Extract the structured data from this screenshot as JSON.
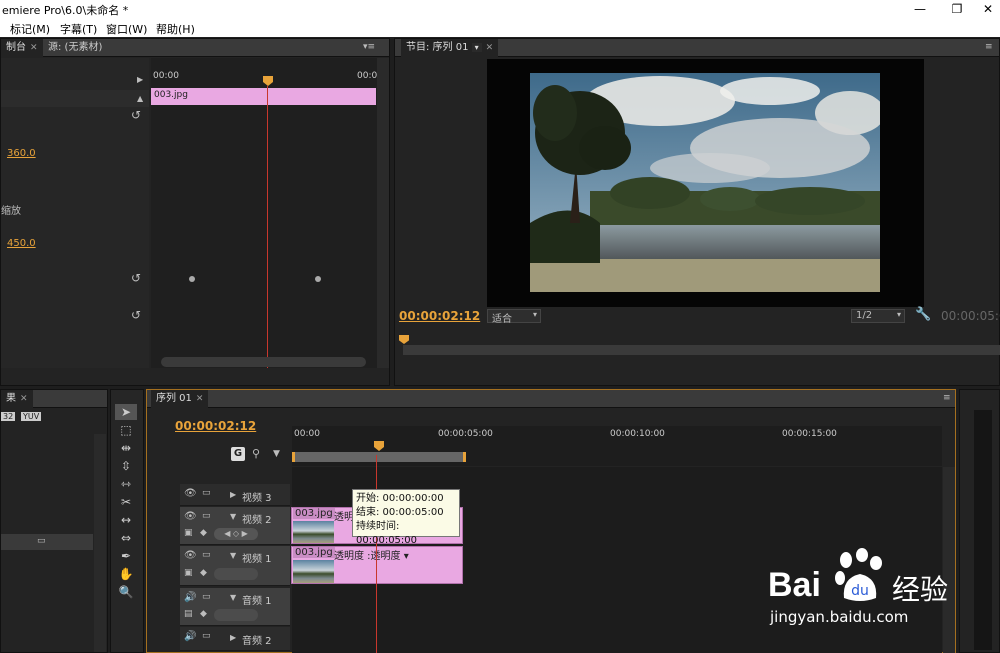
{
  "window": {
    "title": "emiere Pro\\6.0\\未命名 *",
    "minimize": "—",
    "restore": "❐",
    "close": "✕"
  },
  "menu": [
    "标记(M)",
    "字幕(T)",
    "窗口(W)",
    "帮助(H)"
  ],
  "effect_controls": {
    "tab_label": "制台",
    "tab_source": "源: (无素材)",
    "time_start": "00:00",
    "time_end": "00:0",
    "clip_name": "003.jpg",
    "value_1": "360.0",
    "label_scale": "缩放",
    "value_2": "450.0"
  },
  "program_monitor": {
    "tab_label": "节目: 序列 01",
    "timecode": "00:00:02:12",
    "fit_label": "适合",
    "res_label": "1/2",
    "duration": "00:00:05:0"
  },
  "transport": {
    "marker": "▼",
    "in": "{",
    "out": "}",
    "goto_in": "{←",
    "step_back": "◀I",
    "play": "▶",
    "step_fwd": "I▶",
    "goto_out": "→}",
    "lift": "⇈",
    "extract": "⇊",
    "export": "◙"
  },
  "effects_panel": {
    "tab_label": "果",
    "badge_32": "32",
    "badge_yuv": "YUV"
  },
  "sequence": {
    "tab_label": "序列 01",
    "timecode": "00:00:02:12",
    "ruler": [
      "00:00",
      "00:00:05:00",
      "00:00:10:00",
      "00:00:15:00"
    ],
    "tracks": {
      "v3": "视频 3",
      "v2": "视频 2",
      "v1": "视频 1",
      "a1": "音频 1",
      "a2": "音频 2"
    },
    "clip_v2_name": "003.jpg",
    "clip_v2_effect": "透明",
    "clip_v1_name": "003.jpg",
    "clip_v1_effect": "透明度 :透明度 ▾",
    "tooltip": {
      "start": "开始: 00:00:00:00",
      "end": "结束: 00:00:05:00",
      "duration": "持续时间: 00:00:05:00"
    }
  },
  "watermark": {
    "brand": "Bai",
    "brand2": "经验",
    "url": "jingyan.baidu.com"
  }
}
